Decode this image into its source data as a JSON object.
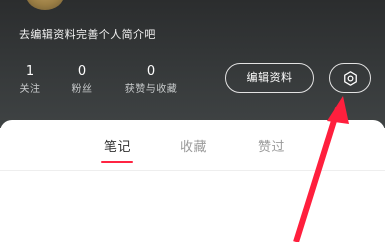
{
  "profile": {
    "bio_prompt": "去编辑资料完善个人简介吧",
    "stats": [
      {
        "value": "1",
        "label": "关注"
      },
      {
        "value": "0",
        "label": "粉丝"
      },
      {
        "value": "0",
        "label": "获赞与收藏"
      }
    ],
    "edit_profile_label": "编辑资料",
    "settings_icon": "gear-icon"
  },
  "tabs": {
    "items": [
      {
        "label": "笔记",
        "active": true
      },
      {
        "label": "收藏",
        "active": false
      },
      {
        "label": "赞过",
        "active": false
      }
    ]
  },
  "colors": {
    "header_bg": "#343738",
    "accent": "#ff2442",
    "annotation_arrow": "#ff1f3d"
  }
}
